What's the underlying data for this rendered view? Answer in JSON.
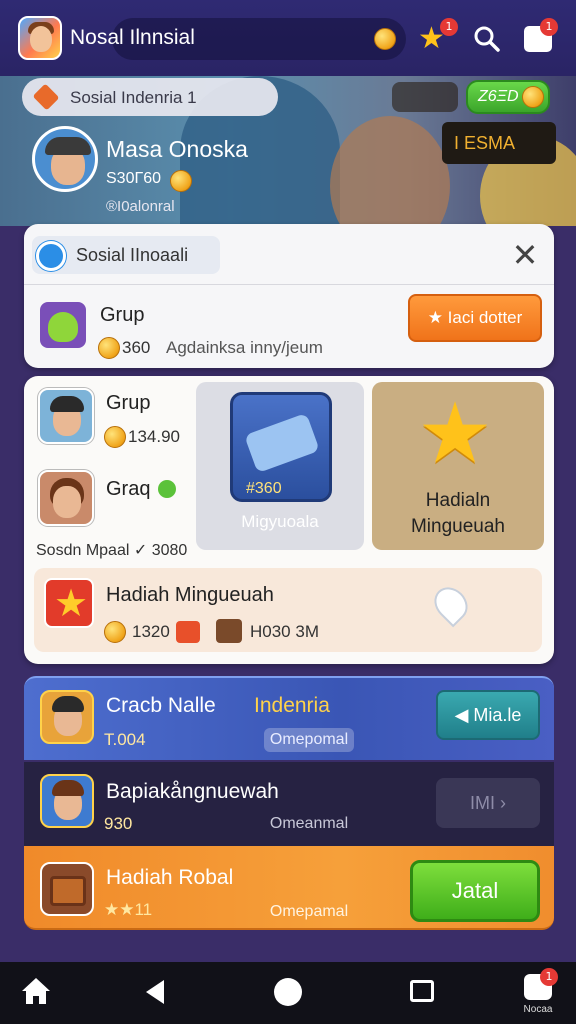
{
  "header": {
    "app_title": "Nosal Ilnnsial",
    "star_badge": "1",
    "gift_badge": "1"
  },
  "hero": {
    "location_text": "Sosial Indenria 1",
    "green_pill_value": "Z6ΞD",
    "user_name": "Masa Onoska",
    "user_score": "S30Γ60",
    "user_handle": "®I0alonral",
    "dark_pill_text": "I ESMA"
  },
  "social_card": {
    "search_text": "Sosial IInoaali",
    "close_symbol": "✕",
    "group_title": "Grup",
    "group_score": "360",
    "group_subtitle": "Agdainksa inny/jeum",
    "action_label": "★ Iaci dotter"
  },
  "mid_panel": {
    "group1_title": "Grup",
    "group1_score": "134.90",
    "group2_title": "Graq",
    "social_row_text": "Sosdn Mpaal ✓ 3080",
    "tile_gray_score": "#360",
    "tile_gray_label": "Migyuoalа",
    "tile_tan_label": "Hadialn Minguеuah",
    "hadiah_title": "Hadiah Mingueuah",
    "hadiah_value1": "1320",
    "hadiah_value2": "H030 3M"
  },
  "leaderboard": {
    "row1_name": "Cracb Nalle",
    "row1_tag": "Indenria",
    "row1_score": "T.004",
    "row1_status": "Omepomal",
    "row1_button": "◀ Mia.le",
    "row2_name": "Bapiakångnuewah",
    "row2_score": "930",
    "row2_status": "Omeanmal",
    "row2_button": "IMI ›",
    "row3_name": "Hadiah Robal",
    "row3_score": "★★11",
    "row3_status": "Omepamal",
    "row3_button": "Jatal"
  },
  "bottom_nav": {
    "notif_badge": "1",
    "profile_label": "Nocaa"
  }
}
